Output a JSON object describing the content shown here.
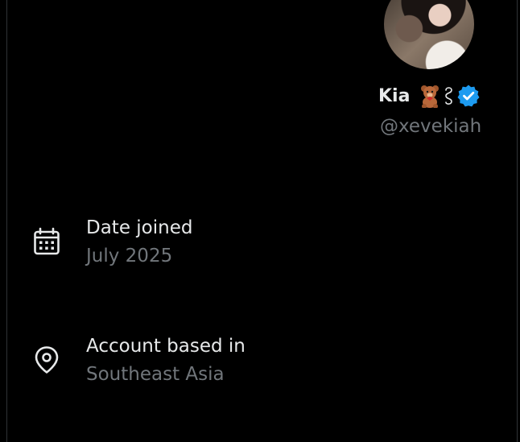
{
  "profile": {
    "display_name": "Kia",
    "emoji_icons": [
      "teddy-bear-icon",
      "swirl-icon"
    ],
    "verified_icon": "verified-badge-icon",
    "handle": "@xevekiah"
  },
  "details": [
    {
      "icon": "calendar-icon",
      "label": "Date joined",
      "value": "July 2025"
    },
    {
      "icon": "location-pin-icon",
      "label": "Account based in",
      "value": "Southeast Asia"
    }
  ],
  "colors": {
    "background": "#000000",
    "primary_text": "#e7e9ea",
    "secondary_text": "#71767b",
    "verified_blue": "#1d9bf0",
    "border": "#2f3336"
  }
}
